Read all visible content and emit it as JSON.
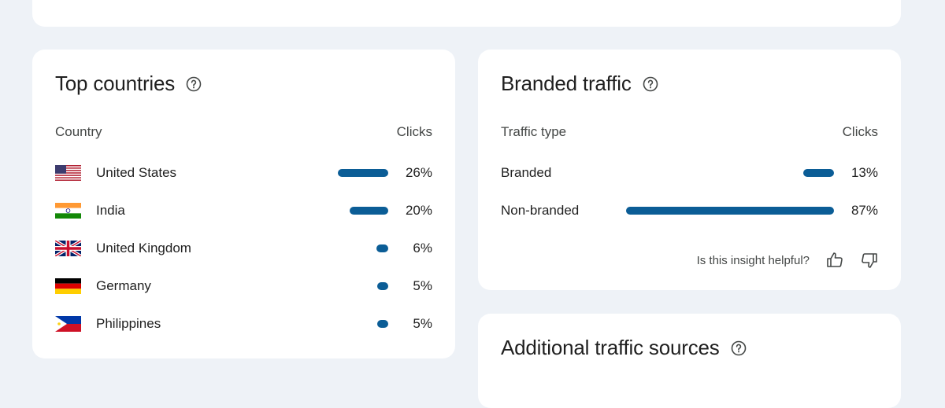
{
  "countries_card": {
    "title": "Top countries",
    "help_icon": "help-circle-icon",
    "col_left": "Country",
    "col_right": "Clicks",
    "rows": [
      {
        "flag": "us-flag-icon",
        "label": "United States",
        "value": "26%",
        "share": 0.26
      },
      {
        "flag": "in-flag-icon",
        "label": "India",
        "value": "20%",
        "share": 0.2
      },
      {
        "flag": "gb-flag-icon",
        "label": "United Kingdom",
        "value": "6%",
        "share": 0.06
      },
      {
        "flag": "de-flag-icon",
        "label": "Germany",
        "value": "5%",
        "share": 0.05
      },
      {
        "flag": "ph-flag-icon",
        "label": "Philippines",
        "value": "5%",
        "share": 0.05
      }
    ]
  },
  "branded_card": {
    "title": "Branded traffic",
    "help_icon": "help-circle-icon",
    "col_left": "Traffic type",
    "col_right": "Clicks",
    "rows": [
      {
        "label": "Branded",
        "value": "13%",
        "share": 0.13
      },
      {
        "label": "Non-branded",
        "value": "87%",
        "share": 0.87
      }
    ],
    "feedback_text": "Is this insight helpful?",
    "thumbs_up_icon": "thumbs-up-icon",
    "thumbs_down_icon": "thumbs-down-icon"
  },
  "additional_card": {
    "title": "Additional traffic sources",
    "help_icon": "help-circle-icon"
  },
  "colors": {
    "background": "#eef2f7",
    "card": "#ffffff",
    "bar": "#0b5d96",
    "text": "#1f1f1f",
    "muted": "#444746"
  }
}
